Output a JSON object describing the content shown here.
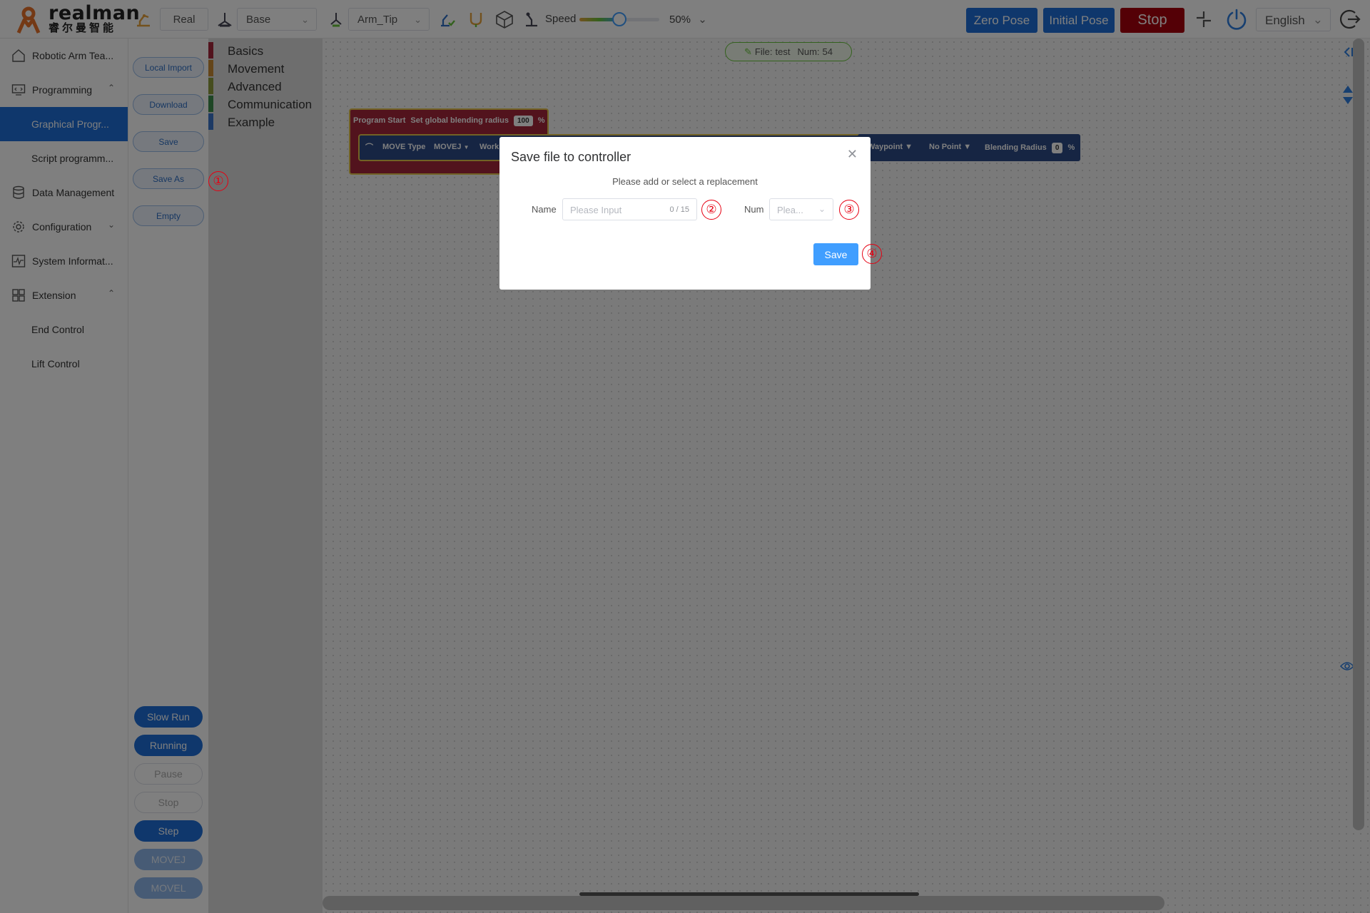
{
  "brand": {
    "name": "realman",
    "subtitle": "睿尔曼智能",
    "color": "#e8732a"
  },
  "topbar": {
    "mode": "Real",
    "frame": "Base",
    "tool": "Arm_Tip",
    "speed_label": "Speed",
    "speed_value": "50%",
    "speed_percent": 50,
    "zero_pose": "Zero Pose",
    "initial_pose": "Initial Pose",
    "stop": "Stop",
    "language": "English",
    "accent": "#1e6fd8",
    "stop_color": "#a8000d"
  },
  "sidebar": {
    "items": [
      {
        "label": "Robotic Arm Tea...",
        "icon": "home-icon"
      },
      {
        "label": "Programming",
        "icon": "code-monitor-icon"
      },
      {
        "label": "Graphical Progr...",
        "icon": ""
      },
      {
        "label": "Script programm...",
        "icon": ""
      },
      {
        "label": "Data Management",
        "icon": "database-icon"
      },
      {
        "label": "Configuration",
        "icon": "gear-icon"
      },
      {
        "label": "System Informat...",
        "icon": "activity-icon"
      },
      {
        "label": "Extension",
        "icon": "grid-icon"
      },
      {
        "label": "End Control",
        "icon": ""
      },
      {
        "label": "Lift Control",
        "icon": ""
      }
    ]
  },
  "actions": {
    "local_import": "Local Import",
    "download": "Download",
    "save": "Save",
    "save_as": "Save As",
    "empty": "Empty"
  },
  "run": {
    "slow_run": "Slow Run",
    "running": "Running",
    "pause": "Pause",
    "stop": "Stop",
    "step": "Step",
    "movej": "MOVEJ",
    "movel": "MOVEL"
  },
  "categories": [
    {
      "label": "Basics",
      "color": "#a5273a"
    },
    {
      "label": "Movement",
      "color": "#c88a32"
    },
    {
      "label": "Advanced",
      "color": "#8c9a3c"
    },
    {
      "label": "Communication",
      "color": "#3c8c4a"
    },
    {
      "label": "Example",
      "color": "#3a74c8"
    }
  ],
  "canvas": {
    "file_label": "File:",
    "file_name": "test",
    "num_label": "Num:",
    "num_value": "54",
    "program_start": "Program Start",
    "blend_label": "Set global blending radius",
    "blend_value": "100",
    "percent": "%",
    "move_type_label": "MOVE Type",
    "move_type_value": "MOVEJ",
    "work_label": "Work",
    "waypoint": "Waypoint",
    "no_point": "No Point",
    "blending_radius": "Blending Radius",
    "blending_radius_value": "0",
    "percent2": "%"
  },
  "dialog": {
    "title": "Save file to controller",
    "subtitle": "Please add or select a replacement",
    "name_label": "Name",
    "name_placeholder": "Please Input",
    "name_count": "0 / 15",
    "num_label": "Num",
    "num_placeholder": "Plea...",
    "save": "Save"
  },
  "markers": {
    "m1": "①",
    "m2": "②",
    "m3": "③",
    "m4": "④"
  }
}
